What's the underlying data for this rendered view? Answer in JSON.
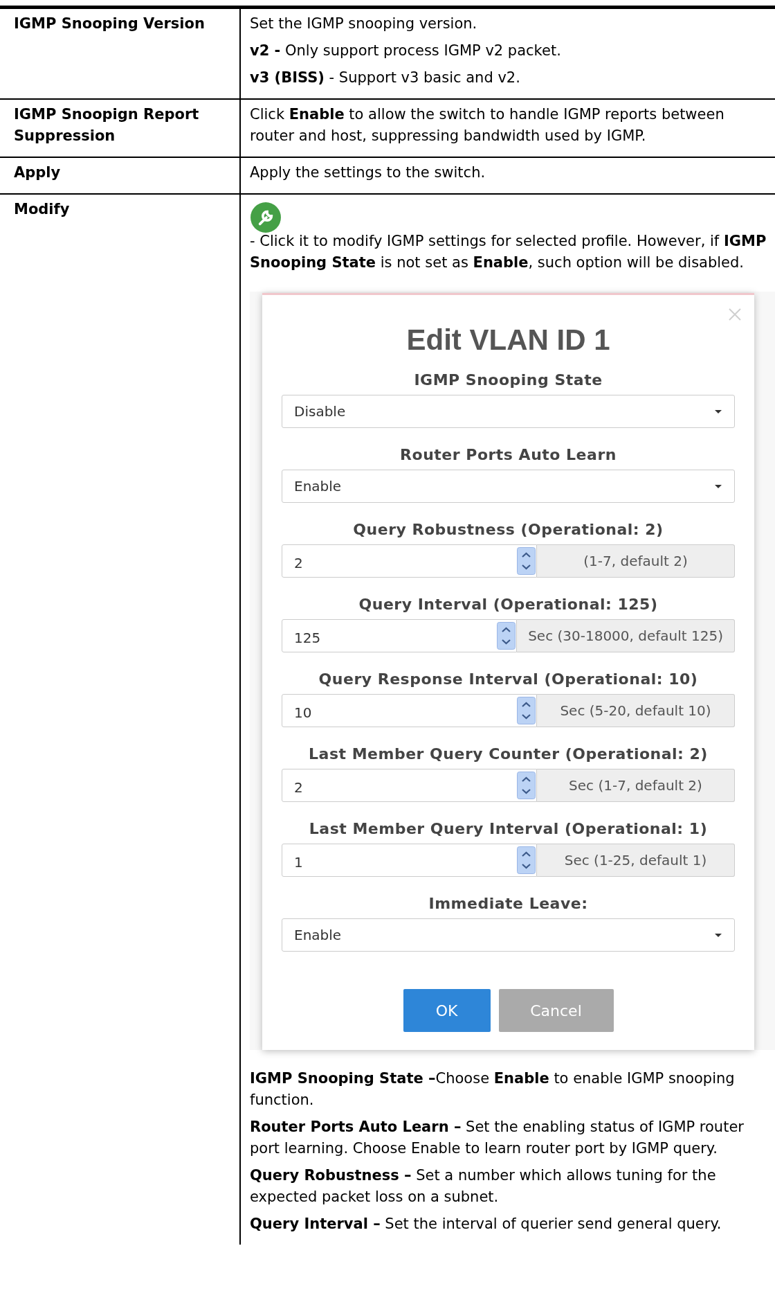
{
  "rows": [
    {
      "label": "IGMP Snooping Version",
      "paragraphs": [
        "Set the IGMP snooping version.",
        "**v2 -** Only support process IGMP v2 packet.",
        "**v3 (BISS)** - Support v3 basic and v2."
      ]
    },
    {
      "label": "IGMP Snoopign Report Suppression",
      "paragraphs": [
        "Click **Enable** to allow the switch to handle IGMP reports between router and host, suppressing bandwidth used by IGMP."
      ]
    },
    {
      "label": "Apply",
      "paragraphs": [
        "Apply the settings to the switch."
      ]
    },
    {
      "label": "Modify",
      "intro": "- Click it to modify IGMP settings for selected profile. However, if **IGMP Snooping State** is not set as **Enable**, such option will be disabled.",
      "dialog": {
        "title": "Edit VLAN ID 1",
        "fields": [
          {
            "kind": "select",
            "label": "IGMP Snooping State",
            "value": "Disable"
          },
          {
            "kind": "select",
            "label": "Router Ports Auto Learn",
            "value": "Enable"
          },
          {
            "kind": "spinner",
            "label": "Query Robustness (Operational: 2)",
            "value": "2",
            "hint": "(1-7, default 2)"
          },
          {
            "kind": "spinner",
            "label": "Query Interval (Operational: 125)",
            "value": "125",
            "hint": "Sec (30-18000, default 125)"
          },
          {
            "kind": "spinner",
            "label": "Query Response Interval (Operational: 10)",
            "value": "10",
            "hint": "Sec (5-20, default 10)"
          },
          {
            "kind": "spinner",
            "label": "Last Member Query Counter (Operational: 2)",
            "value": "2",
            "hint": "Sec (1-7, default 2)"
          },
          {
            "kind": "spinner",
            "label": "Last Member Query Interval (Operational: 1)",
            "value": "1",
            "hint": "Sec (1-25, default 1)"
          },
          {
            "kind": "select",
            "label": "Immediate Leave:",
            "value": "Enable"
          }
        ],
        "buttons": [
          {
            "label": "OK",
            "kind": "primary"
          },
          {
            "label": "Cancel",
            "kind": "secondary"
          }
        ]
      },
      "paragraphs": [
        "**IGMP Snooping State –**Choose **Enable** to enable IGMP snooping function.",
        "**Router Ports Auto Learn –** Set the enabling status of IGMP router port learning. Choose Enable to learn router port by IGMP query.",
        "**Query Robustness –** Set a number which allows tuning for the expected packet loss on a subnet.",
        "**Query Interval –** Set the interval of querier send general query."
      ]
    }
  ]
}
